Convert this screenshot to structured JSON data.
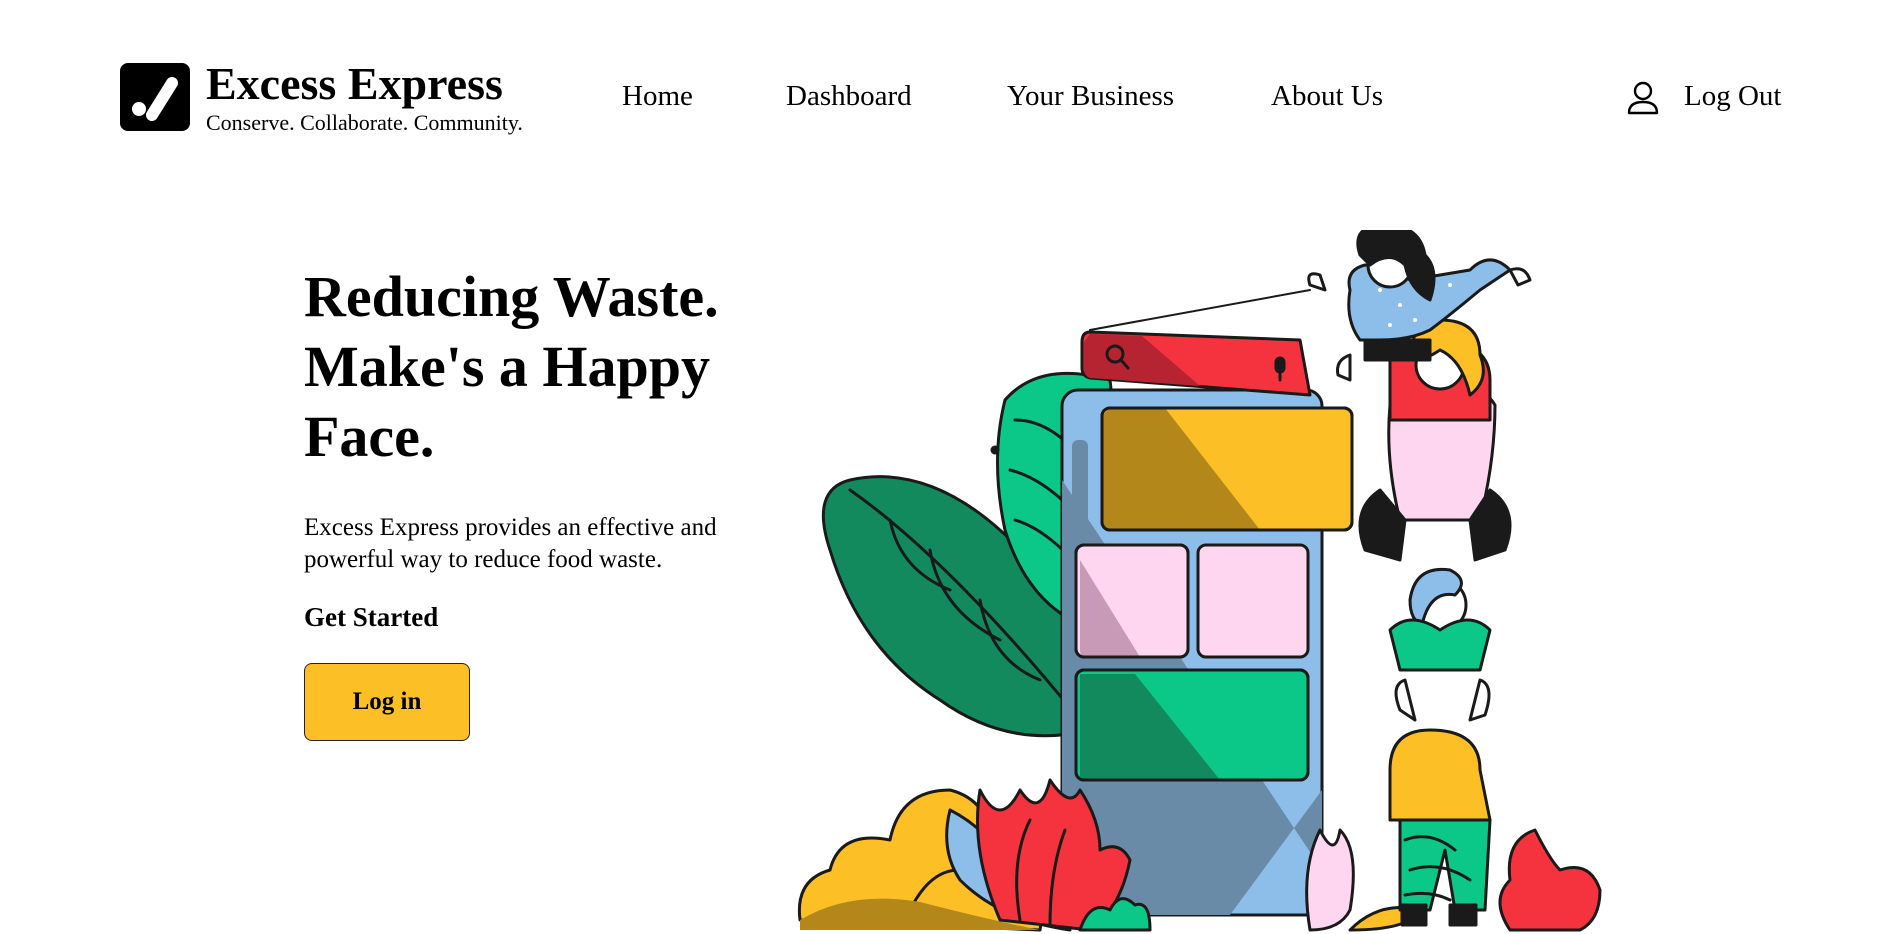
{
  "header": {
    "brand_name": "Excess Express",
    "tagline": "Conserve. Collaborate. Community.",
    "logo_icon": "checkmark-logo-icon",
    "nav": {
      "home": "Home",
      "dashboard": "Dashboard",
      "your_business": "Your Business",
      "about_us": "About Us"
    },
    "logout_label": "Log Out",
    "logout_icon": "user-icon"
  },
  "hero": {
    "title": "Reducing Waste. Make's a Happy Face.",
    "description": "Excess Express provides an effective and powerful way to reduce food waste.",
    "get_started": "Get Started",
    "login_button": "Log in",
    "illustration": "people-stacking-app-interface-illustration"
  },
  "colors": {
    "accent_yellow": "#fdbf26",
    "red": "#f5333f",
    "green": "#0cc888",
    "dark_green": "#128a5e",
    "pink": "#ffd6f0",
    "light_blue": "#8dbeea",
    "black": "#000000",
    "background": "#ffffff"
  }
}
